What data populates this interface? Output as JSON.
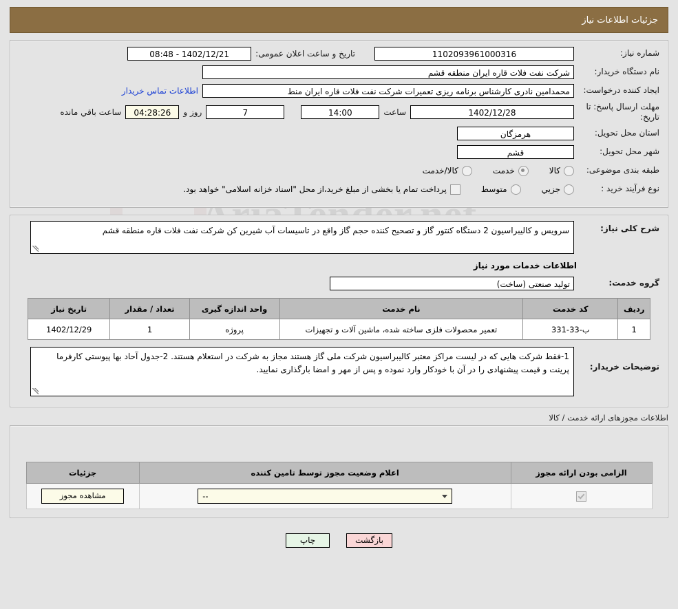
{
  "header": {
    "title": "جزئیات اطلاعات نیاز"
  },
  "watermark": {
    "text": "AriaTender.net"
  },
  "form": {
    "request_number_label": "شماره نیاز:",
    "request_number_value": "1102093961000316",
    "public_announce_label": "تاریخ و ساعت اعلان عمومی:",
    "public_announce_value": "1402/12/21 - 08:48",
    "buyer_org_label": "نام دستگاه خریدار:",
    "buyer_org_value": "شرکت نفت فلات قاره ایران منطقه قشم",
    "creator_label": "ایجاد کننده درخواست:",
    "creator_value": "محمدامین نادری کارشناس برنامه ریزی تعمیرات شرکت نفت فلات قاره ایران منط",
    "contact_link": "اطلاعات تماس خریدار",
    "deadline_label": "مهلت ارسال پاسخ: تا تاریخ:",
    "deadline_date": "1402/12/28",
    "hour_label": "ساعت",
    "deadline_time": "14:00",
    "days_value": "7",
    "days_label": "روز و",
    "remaining_time": "04:28:26",
    "remaining_label": "ساعت باقي مانده",
    "province_label": "استان محل تحویل:",
    "province_value": "هرمزگان",
    "city_label": "شهر محل تحویل:",
    "city_value": "قشم",
    "category_label": "طبقه بندی موضوعی:",
    "category_options": [
      {
        "label": "کالا",
        "checked": false
      },
      {
        "label": "خدمت",
        "checked": true
      },
      {
        "label": "کالا/خدمت",
        "checked": false
      }
    ],
    "process_label": "نوع فرآیند خرید :",
    "process_options": [
      {
        "label": "جزیي",
        "checked": false
      },
      {
        "label": "متوسط",
        "checked": false
      }
    ],
    "treasury_note": "پرداخت تمام یا بخشی از مبلغ خرید،از محل \"اسناد خزانه اسلامی\" خواهد بود."
  },
  "description": {
    "label": "شرح کلی نیاز:",
    "value": "سرویس و کالیبراسیون 2 دستگاه کنتور گاز و تصحیح کننده حجم گاز واقع در تاسیسات آب شیرین کن شرکت نفت فلات قاره منطقه قشم"
  },
  "services_section": {
    "heading": "اطلاعات خدمات مورد نیاز",
    "group_label": "گروه خدمت:",
    "group_value": "تولید صنعتی (ساخت)"
  },
  "table": {
    "columns": [
      "ردیف",
      "کد خدمت",
      "نام خدمت",
      "واحد اندازه گیری",
      "تعداد / مقدار",
      "تاریخ نیاز"
    ],
    "rows": [
      {
        "index": "1",
        "service_code": "ب-33-331",
        "service_name": "تعمیر محصولات فلزی ساخته شده، ماشین آلات و تجهیزات",
        "unit": "پروژه",
        "quantity": "1",
        "need_date": "1402/12/29"
      }
    ]
  },
  "buyer_notes": {
    "label": "توضیحات خریدار:",
    "value": "1-فقط شرکت هایی که در لیست مراکز معتبر کالیبراسیون شرکت ملی گاز هستند مجاز به شرکت در استعلام هستند. 2-جدول آحاد بها پیوستی کارفرما پرینت و قیمت پیشنهادی را در آن با خودکار وارد نموده و پس از مهر و امضا بارگذاری نمایید."
  },
  "permits": {
    "heading": "اطلاعات مجوزهای ارائه خدمت / کالا",
    "columns": [
      "الزامی بودن ارائه مجوز",
      "اعلام وضعیت مجوز توسط تامین کننده",
      "جزئیات"
    ],
    "rows": [
      {
        "required_checked": true,
        "status_value": "--",
        "details_label": "مشاهده مجوز"
      }
    ]
  },
  "footer": {
    "print_label": "چاپ",
    "back_label": "بازگشت"
  }
}
